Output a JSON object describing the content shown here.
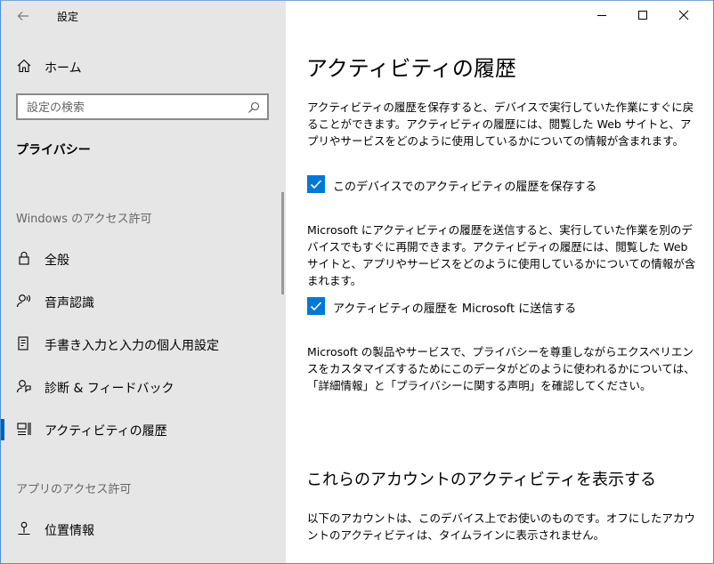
{
  "window": {
    "app_title": "設定",
    "controls": {
      "minimize": "minimize-icon",
      "maximize": "maximize-icon",
      "close": "close-icon"
    }
  },
  "sidebar": {
    "home_label": "ホーム",
    "search": {
      "placeholder": "設定の検索",
      "value": ""
    },
    "section_title": "プライバシー",
    "groups": [
      {
        "header": "Windows のアクセス許可"
      },
      {
        "header": "アプリのアクセス許可"
      }
    ],
    "items": [
      {
        "label": "全般",
        "icon": "lock-icon"
      },
      {
        "label": "音声認識",
        "icon": "speech-icon"
      },
      {
        "label": "手書き入力と入力の個人用設定",
        "icon": "inking-icon"
      },
      {
        "label": "診断 & フィードバック",
        "icon": "feedback-icon"
      },
      {
        "label": "アクティビティの履歴",
        "icon": "timeline-icon",
        "active": true
      },
      {
        "label": "位置情報",
        "icon": "location-icon"
      }
    ]
  },
  "main": {
    "title": "アクティビティの履歴",
    "intro": "アクティビティの履歴を保存すると、デバイスで実行していた作業にすぐに戻ることができます。アクティビティの履歴には、閲覧した Web サイトと、アプリやサービスをどのように使用しているかについての情報が含まれます。",
    "checkbox_store": {
      "label": "このデバイスでのアクティビティの履歴を保存する",
      "checked": true
    },
    "send_desc": "Microsoft にアクティビティの履歴を送信すると、実行していた作業を別のデバイスでもすぐに再開できます。アクティビティの履歴には、閲覧した Web サイトと、アプリやサービスをどのように使用しているかについての情報が含まれます。",
    "checkbox_send": {
      "label": "アクティビティの履歴を Microsoft に送信する",
      "checked": true
    },
    "privacy_text": "Microsoft の製品やサービスで、プライバシーを尊重しながらエクスペリエンスをカスタマイズするためにこのデータがどのように使われるかについては、「詳細情報」と「プライバシーに関する声明」を確認してください。",
    "accounts_title": "これらのアカウントのアクティビティを表示する",
    "accounts_desc": "以下のアカウントは、このデバイス上でお使いのものです。オフにしたアカウントのアクティビティは、タイムラインに表示されません。"
  },
  "colors": {
    "accent": "#0078d7",
    "sidebar_bg": "#e6e6e6",
    "active_indicator": "#0063b1"
  }
}
